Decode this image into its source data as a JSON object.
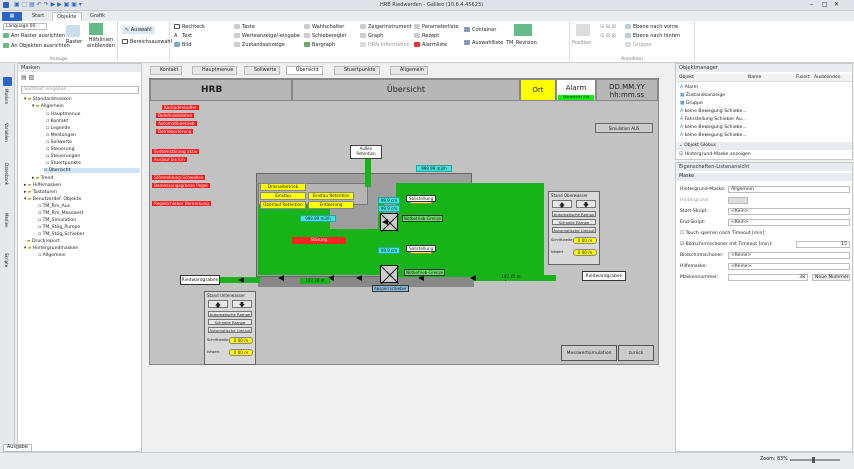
{
  "window": {
    "title": "HRB Riedwerden - Galileo (10.6.4.45623)"
  },
  "ribbon_tabs": [
    "Start",
    "Objekte",
    "Grafik"
  ],
  "ribbon": {
    "language": "Language 00",
    "align_grid": "Am Raster ausrichten",
    "align_objects": "An Objekten ausrichten",
    "grid": "Raster",
    "helplines": "Hilfslinien einblenden",
    "group_anzeige": "Anzeige",
    "select": "Auswahl",
    "area_select": "Bereichsauswahl",
    "col1": [
      "Rechteck",
      "Text",
      "Bild"
    ],
    "col2": [
      "Taste",
      "Werteanzeige/-eingabe",
      "Zustandsanzeige"
    ],
    "col3": [
      "Wahlschalter",
      "Schieberegler",
      "Bargraph"
    ],
    "col4": [
      "Zeigerinstrument",
      "Graph",
      "HRN-Information"
    ],
    "col5": [
      "Parameterliste",
      "Rezept",
      "Alarmliste"
    ],
    "container": "Container",
    "auswahlliste": "Auswahlliste",
    "tm_revision": "TM_Revision",
    "position": "Position",
    "arrange": [
      "Ebene nach vorne",
      "Ebene nach hinten",
      "Gruppe"
    ],
    "group_anordnen": "Anordnen"
  },
  "masks_panel": {
    "title": "Masken",
    "search_placeholder": "Suchtext eingeben...",
    "tree": [
      "Standardmasken",
      "Allgemein",
      "Hauptmenue",
      "Kontakt",
      "Legende",
      "Meldungen",
      "Sollwerte",
      "Steuerung",
      "Steuerungen",
      "Stuertpunkte",
      "Übersicht",
      "Trend",
      "Hilfemasken",
      "Tastaturen",
      "Benutzerdef. Objekte",
      "TM_Rm_Aus",
      "TM_Rm_Messwert",
      "TM_Simulation",
      "TM_Stög_Pumpe",
      "TM_Stög_Schieber",
      "Druckreport",
      "Hintergrundmasken",
      "Allgemein"
    ]
  },
  "side_tabs": [
    "Masken",
    "Variablen",
    "Datenbank",
    "Medien",
    "Skripte"
  ],
  "doc_tabs": [
    "Kontakt",
    "Hauptmenue",
    "Sollwerte",
    "Übersicht",
    "Stuertpunkte",
    "Allgemein"
  ],
  "scada": {
    "logo": "HRB",
    "title": "Übersicht",
    "ort": "Ort",
    "alarm": "Alarm",
    "date": "DD.MM.YY",
    "time": "hh:mm.ss",
    "stoermelder": "Störmelder EIN",
    "simulation": "Simulation AUS",
    "red_labels": [
      "Kaskadenbuffer",
      "Befehlsleitdaten",
      "Automatikbetrieb",
      "Betriebsstörung",
      "Systemstörung aktiv",
      "Auslauf bis km",
      "Störmeldung Schwellen",
      "Bemessungsgrenze Pegel",
      "Regelschieber Bemerkung"
    ],
    "ausen_retention": "Außen Retention",
    "value_top": "999.99 m3/h",
    "drosselbetrieb": "Drosselbetrieb",
    "einstau": "Einstau",
    "einstau_retention": "Einstau Retention",
    "ueberlauf": "Überlauf Retention",
    "entleerung": "Entleerung",
    "value_mid": "999.99 m3/h",
    "stoerung": "Störung",
    "v1": "99.9 cm",
    "v2": "99.9 cm",
    "p1": "99.9 %",
    "p2": "99.9 %",
    "sollstellung": "Sollstellung",
    "notgrenze": "Notbetrieb-Grenze",
    "absperr": "Absperrschieber",
    "absperr2": "Absperrschieber",
    "riedgraben_l": "Riedwardgraben",
    "riedgraben_r": "Riedwardgraben",
    "pipe_l": "187.20 m",
    "pipe_r": "187.45 m",
    "oben_title": "Stand Oberwasser",
    "unten_title": "Stand Unterwasser",
    "ctrl_btns": [
      "Automatische Rampe",
      "Schnelle Rampe",
      "Automatische Umlaut"
    ],
    "soll_label": "Schrittweite",
    "soll_val": "0.00 m",
    "ist_label": "Istwert",
    "ist_val": "0.00 m",
    "messwert": "Messwertsimulation",
    "zurueck": "zurück"
  },
  "objects_panel": {
    "title": "Objektmanager",
    "columns": [
      "Objekt",
      "Name",
      "Fixiert",
      "Ausblenden"
    ],
    "items": [
      "Alarm",
      "Zustandsanzeige",
      "Gruppe",
      "keine Bewegung Schiebe...",
      "Fahrstellung Schieber Au...",
      "keine Bewegung Schiebe...",
      "keine Bewegung Schiebe..."
    ],
    "group_title": "Objekt Globus",
    "bg_mask_chk": "Hintergrund-Maske anzeigen"
  },
  "props_panel": {
    "title": "Eigenschaften-Listenansicht",
    "section": "Maske",
    "rows": [
      {
        "label": "Hintergrund-Maske:",
        "value": "Allgemein"
      },
      {
        "label": "Hintergrund:",
        "value": ""
      },
      {
        "label": "Start-Skript:",
        "value": "<Kein>"
      },
      {
        "label": "End-Skript:",
        "value": "<Kein>"
      },
      {
        "label": "Touch sperren nach Timeout [min]:",
        "value": ""
      },
      {
        "label": "Bildschirmschoner mit Timeout [min]:",
        "value": "15"
      },
      {
        "label": "Bildschirmschoner:",
        "value": "<Keine>"
      },
      {
        "label": "Hilfemaske:",
        "value": "<Keine>"
      },
      {
        "label": "Maskennummer:",
        "value": "38"
      }
    ],
    "neue_nummer": "Neue Nummer"
  },
  "status": {
    "tab": "Ausgabe",
    "zoom": "Zoom: 83%"
  }
}
